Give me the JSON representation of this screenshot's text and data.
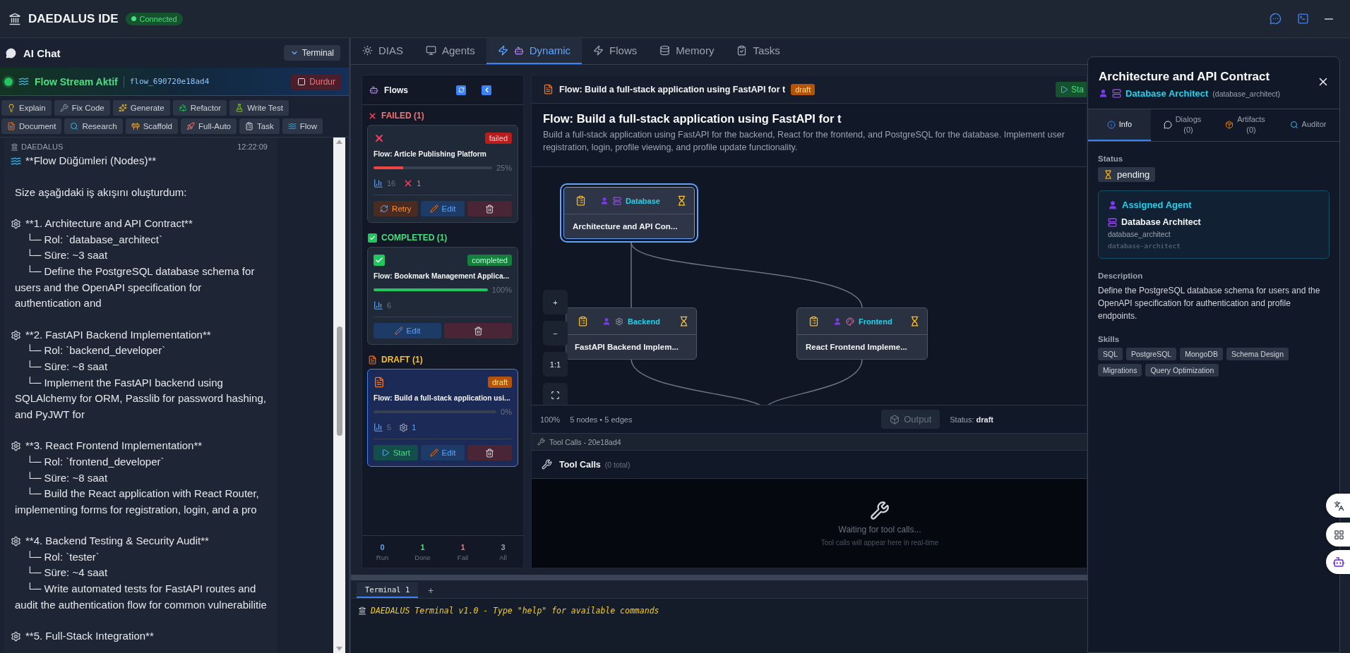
{
  "app": {
    "title": "DAEDALUS IDE",
    "connection": {
      "label": "Connected",
      "on": true
    }
  },
  "chat_panel": {
    "title": "AI Chat",
    "terminal_button": "Terminal",
    "stream": {
      "label": "Flow Stream Aktif",
      "flow_id": "flow_690720e18ad4",
      "stop_button": "Durdur",
      "active": true
    },
    "quick_actions": [
      "Explain",
      "Fix Code",
      "Generate",
      "Refactor",
      "Write Test",
      "Document",
      "Research",
      "Scaffold",
      "Full-Auto",
      "Task",
      "Flow"
    ],
    "message": {
      "sender": "DAEDALUS",
      "time": "12:22:09",
      "heading": "**Flow Düğümleri (Nodes)**",
      "intro": "Size aşağıdaki iş akışını oluşturdum:",
      "steps": [
        {
          "title": "**1. Architecture and API Contract**",
          "details": [
            "└─ Rol: `database_architect`",
            "└─ Süre: ~3 saat",
            "└─ Define the PostgreSQL database schema for users and the OpenAPI specification for authentication and"
          ]
        },
        {
          "title": "**2. FastAPI Backend Implementation**",
          "details": [
            "└─ Rol: `backend_developer`",
            "└─ Süre: ~8 saat",
            "└─ Implement the FastAPI backend using SQLAlchemy for ORM, Passlib for password hashing, and PyJWT for"
          ]
        },
        {
          "title": "**3. React Frontend Implementation**",
          "details": [
            "└─ Rol: `frontend_developer`",
            "└─ Süre: ~8 saat",
            "└─ Build the React application with React Router, implementing forms for registration, login, and a pro"
          ]
        },
        {
          "title": "**4. Backend Testing & Security Audit**",
          "details": [
            "└─ Rol: `tester`",
            "└─ Süre: ~4 saat",
            "└─ Write automated tests for FastAPI routes and audit the authentication flow for common vulnerabilitie"
          ]
        },
        {
          "title": "**5. Full-Stack Integration**"
        }
      ]
    }
  },
  "tabs": [
    {
      "label": "DIAS",
      "selected": false
    },
    {
      "label": "Agents",
      "selected": false
    },
    {
      "label": "Dynamic",
      "selected": true
    },
    {
      "label": "Flows",
      "selected": false
    },
    {
      "label": "Memory",
      "selected": false
    },
    {
      "label": "Tasks",
      "selected": false
    }
  ],
  "flows_sidebar": {
    "title": "Flows",
    "groups": [
      {
        "kind": "failed",
        "label": "FAILED (1)",
        "flows": [
          {
            "name": "Flow: Article Publishing Platform",
            "badge": "failed",
            "level": 0.25,
            "percent": "25%",
            "selected": false,
            "stats": [
              {
                "kind": "nodes",
                "value": "16"
              },
              {
                "kind": "failed",
                "value": "1"
              }
            ],
            "actions": [
              {
                "kind": "retry",
                "label": "Retry"
              },
              {
                "kind": "edit",
                "label": "Edit"
              },
              {
                "kind": "delete"
              }
            ]
          }
        ]
      },
      {
        "kind": "completed",
        "label": "COMPLETED (1)",
        "flows": [
          {
            "name": "Flow: Bookmark Management Applica...",
            "badge": "completed",
            "level": 1,
            "percent": "100%",
            "selected": false,
            "stats": [
              {
                "kind": "nodes",
                "value": "6"
              }
            ],
            "actions": [
              {
                "kind": "edit",
                "label": "Edit"
              },
              {
                "kind": "delete"
              }
            ]
          }
        ]
      },
      {
        "kind": "draft",
        "label": "DRAFT (1)",
        "flows": [
          {
            "name": "Flow: Build a full-stack application usi...",
            "badge": "draft",
            "level": 0,
            "percent": "0%",
            "selected": true,
            "stats": [
              {
                "kind": "nodes",
                "value": "5"
              },
              {
                "kind": "agents",
                "value": "1"
              }
            ],
            "actions": [
              {
                "kind": "start",
                "label": "Start"
              },
              {
                "kind": "edit",
                "label": "Edit"
              },
              {
                "kind": "delete"
              }
            ]
          }
        ]
      }
    ],
    "stats": [
      {
        "value": "0",
        "label": "Run",
        "color": "#60a5fa"
      },
      {
        "value": "1",
        "label": "Done",
        "color": "#4ade80"
      },
      {
        "value": "1",
        "label": "Fail",
        "color": "#f87171"
      },
      {
        "value": "3",
        "label": "All",
        "color": "#9ca3af"
      }
    ]
  },
  "flow_header": {
    "title": "Flow: Build a full-stack application using FastAPI for t",
    "badge": "draft",
    "start_button": "Sta"
  },
  "flow_detail": {
    "title": "Flow: Build a full-stack application using FastAPI for t",
    "description": "Build a full-stack application using FastAPI for the backend, React for the frontend, and PostgreSQL for the database. Implement user registration, login, profile viewing, and profile update functionality."
  },
  "canvas": {
    "nodes": [
      {
        "role": "Database",
        "title": "Architecture and API Con...",
        "selected": true
      },
      {
        "role": "Backend",
        "title": "FastAPI Backend Implem...",
        "selected": false
      },
      {
        "role": "Frontend",
        "title": "React Frontend Impleme...",
        "selected": false
      }
    ],
    "zoom_controls": [
      "+",
      "−",
      "1:1"
    ],
    "zoom": "100%",
    "summary": "5 nodes • 5 edges",
    "output_button": "Output",
    "status": "Status: **draft**"
  },
  "tool_calls": {
    "bar": "Tool Calls - 20e18ad4",
    "title": "Tool Calls",
    "count": "(0 total)",
    "empty_title": "Waiting for tool calls...",
    "empty_hint": "Tool calls will appear here in real-time"
  },
  "terminal": {
    "tabs": [
      {
        "label": "Terminal 1",
        "selected": true
      }
    ],
    "add_button": "+",
    "line": "DAEDALUS Terminal v1.0 - Type \"help\" for available commands"
  },
  "node_drawer": {
    "title": "Architecture and API Contract",
    "agent_name": "Database Architect",
    "agent_id": "(database_architect)",
    "tabs": [
      {
        "label": "Info",
        "selected": true
      },
      {
        "label": "Dialogs",
        "count": "(0)",
        "selected": false
      },
      {
        "label": "Artifacts",
        "count": "(0)",
        "selected": false
      },
      {
        "label": "Auditor",
        "selected": false
      }
    ],
    "status_label": "Status",
    "status": "pending",
    "assigned": {
      "title": "Assigned Agent",
      "name": "Database Architect",
      "id": "database_architect",
      "slug": "database-architect"
    },
    "description_label": "Description",
    "description": "Define the PostgreSQL database schema for users and the OpenAPI specification for authentication and profile endpoints.",
    "skills_label": "Skills",
    "skills": [
      "SQL",
      "PostgreSQL",
      "MongoDB",
      "Schema Design",
      "Migrations",
      "Query Optimization"
    ]
  }
}
